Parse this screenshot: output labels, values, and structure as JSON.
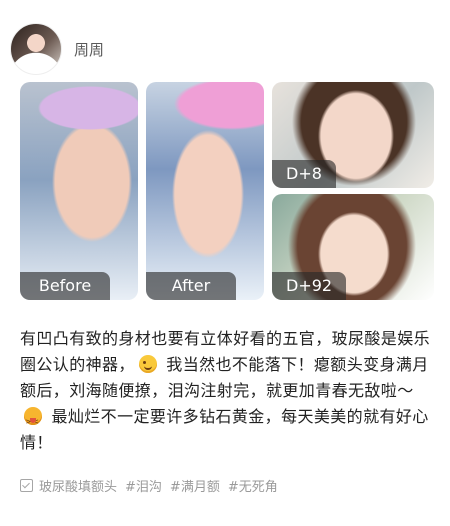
{
  "header": {
    "username": "周周",
    "avatar_icon": "profile-avatar"
  },
  "photos": [
    {
      "label": "Before"
    },
    {
      "label": "After"
    },
    {
      "label": "D+8"
    },
    {
      "label": "D+92"
    }
  ],
  "post": {
    "segment1": "有凹凸有致的身材也要有立体好看的五官，玻尿酸是娱乐圈公认的神器，",
    "emoji1": "wink-emoji",
    "segment2": " 我当然也不能落下！瘪额头变身满月额后，刘海随便撩，泪沟注射完，就更加青春无敌啦～",
    "emoji2": "tongue-out-emoji",
    "segment3": " 最灿烂不一定要许多钻石黄金，每天美美的就有好心情！"
  },
  "tags": [
    "玻尿酸填额头",
    "#泪沟",
    "#满月额",
    "#无死角"
  ]
}
